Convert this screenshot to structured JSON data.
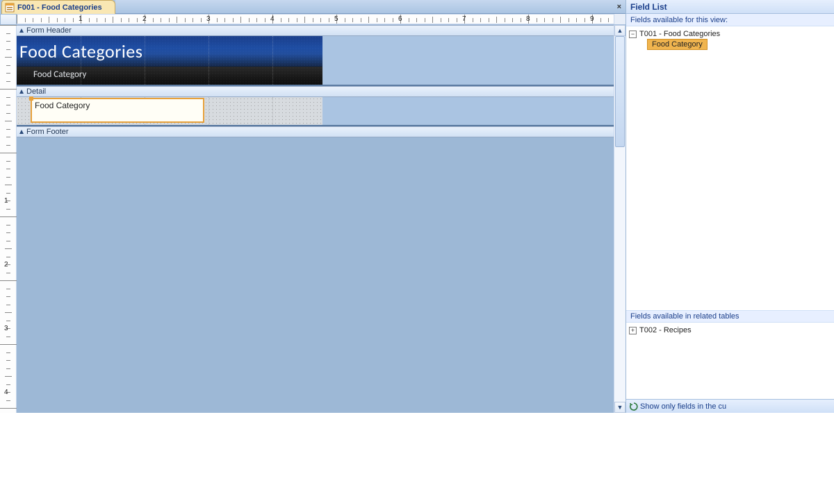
{
  "tab": {
    "title": "F001 - Food Categories"
  },
  "close_glyph": "×",
  "sections": {
    "header_label": "Form Header",
    "detail_label": "Detail",
    "footer_label": "Form Footer"
  },
  "form": {
    "title_text": "Food Categories",
    "column_label": "Food Category",
    "bound_field_text": "Food Category"
  },
  "ruler": {
    "inches": [
      1,
      2,
      3,
      4,
      5,
      6,
      7,
      8,
      9
    ],
    "v_inches": [
      1,
      2,
      3,
      4
    ]
  },
  "field_list": {
    "title": "Field List",
    "available_label": "Fields available for this view:",
    "related_label": "Fields available in related tables",
    "show_only_label": "Show only fields in the cu",
    "tables": {
      "primary": {
        "name": "T001 - Food Categories",
        "expanded": true,
        "fields": [
          "Food Category"
        ]
      },
      "related": [
        {
          "name": "T002 - Recipes",
          "expanded": false
        }
      ]
    }
  }
}
